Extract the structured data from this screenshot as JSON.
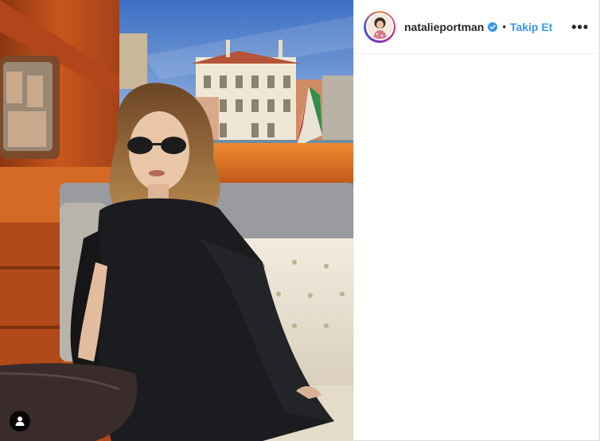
{
  "post": {
    "user": {
      "username": "natalieportman",
      "verified": true,
      "follow_label": "Takip Et",
      "separator": "•",
      "more_label": "•••"
    },
    "photo": {
      "user_tag_icon": "person-icon"
    }
  },
  "colors": {
    "follow_blue": "#3897f0",
    "verified_blue": "#3897f0",
    "text_dark": "#262626",
    "border": "#efefef"
  }
}
